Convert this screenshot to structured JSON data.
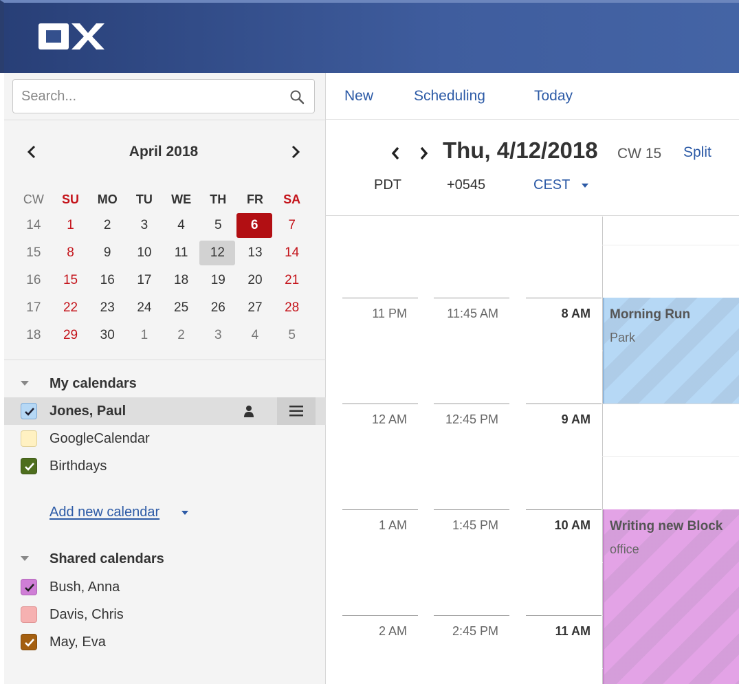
{
  "app": {
    "logo_text": "OX"
  },
  "search": {
    "placeholder": "Search..."
  },
  "mini_calendar": {
    "title": "April 2018",
    "weekday_headers": [
      "CW",
      "SU",
      "MO",
      "TU",
      "WE",
      "TH",
      "FR",
      "SA"
    ],
    "weeks": [
      {
        "cw": "14",
        "days": [
          "1",
          "2",
          "3",
          "4",
          "5",
          "6",
          "7"
        ]
      },
      {
        "cw": "15",
        "days": [
          "8",
          "9",
          "10",
          "11",
          "12",
          "13",
          "14"
        ]
      },
      {
        "cw": "16",
        "days": [
          "15",
          "16",
          "17",
          "18",
          "19",
          "20",
          "21"
        ]
      },
      {
        "cw": "17",
        "days": [
          "22",
          "23",
          "24",
          "25",
          "26",
          "27",
          "28"
        ]
      },
      {
        "cw": "18",
        "days": [
          "29",
          "30",
          "1",
          "2",
          "3",
          "4",
          "5"
        ]
      }
    ],
    "today": "6",
    "selected": "12"
  },
  "my_calendars": {
    "header": "My calendars",
    "items": [
      {
        "name": "Jones, Paul",
        "color": "#b6d8f5",
        "checked": true
      },
      {
        "name": "GoogleCalendar",
        "color": "#fff1c2",
        "checked": false
      },
      {
        "name": "Birthdays",
        "color": "#4e6e1e",
        "checked": true
      }
    ],
    "add_label": "Add new calendar"
  },
  "shared_calendars": {
    "header": "Shared calendars",
    "items": [
      {
        "name": "Bush, Anna",
        "color": "#cf7ed6",
        "checked": true
      },
      {
        "name": "Davis, Chris",
        "color": "#f6b1b1",
        "checked": false
      },
      {
        "name": "May, Eva",
        "color": "#a45f10",
        "checked": true
      }
    ]
  },
  "toolbar": {
    "new": "New",
    "scheduling": "Scheduling",
    "today": "Today"
  },
  "day_header": {
    "date": "Thu, 4/12/2018",
    "cw": "CW 15",
    "split": "Split",
    "timezones": [
      "PDT",
      "+0545",
      "CEST"
    ]
  },
  "time_rows": [
    {
      "pdt": "11 PM",
      "np": "11:45 AM",
      "cest": "8 AM"
    },
    {
      "pdt": "12 AM",
      "np": "12:45 PM",
      "cest": "9 AM"
    },
    {
      "pdt": "1 AM",
      "np": "1:45 PM",
      "cest": "10 AM"
    },
    {
      "pdt": "2 AM",
      "np": "2:45 PM",
      "cest": "11 AM"
    }
  ],
  "events": [
    {
      "title": "Morning Run",
      "location": "Park",
      "color": "#b6d8f5",
      "border": "#8fb6dc"
    },
    {
      "title": "Writing new Block",
      "location": "office",
      "color": "#e3a3e6",
      "border": "#c584c9"
    }
  ]
}
